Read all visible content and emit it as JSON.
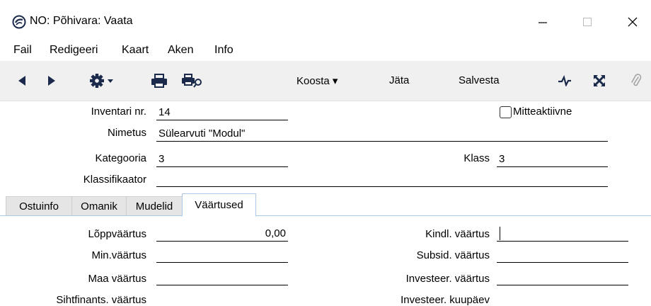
{
  "window": {
    "title": "NO: Põhivara: Vaata",
    "minimize_glyph": "—",
    "maximize_glyph": "☐",
    "close_glyph": "✕"
  },
  "menu": [
    "Fail",
    "Redigeeri",
    "Kaart",
    "Aken",
    "Info"
  ],
  "toolbar": {
    "koosta": "Koosta ▾",
    "jata": "Jäta",
    "salvesta": "Salvesta",
    "icons": [
      "prev-record-icon",
      "next-record-icon",
      "gear-menu-icon",
      "print-icon",
      "print-preview-icon",
      "activity-icon",
      "expand-icon",
      "attachment-icon"
    ]
  },
  "form": {
    "inventari_nr_label": "Inventari nr.",
    "inventari_nr_value": "14",
    "mitteaktiivne_label": "Mitteaktiivne",
    "nimetus_label": "Nimetus",
    "nimetus_value": "Sülearvuti \"Modul\"",
    "kategooria_label": "Kategooria",
    "kategooria_value": "3",
    "klass_label": "Klass",
    "klass_value": "3",
    "klassifikaator_label": "Klassifikaator",
    "klassifikaator_value": ""
  },
  "tabs": [
    "Ostuinfo",
    "Omanik",
    "Mudelid",
    "Väärtused"
  ],
  "active_tab": "Väärtused",
  "values_tab": {
    "loppvaartus_label": "Lõppväärtus",
    "loppvaartus_value": "0,00",
    "min_vaartus_label": "Min.väärtus",
    "maa_vaartus_label": "Maa väärtus",
    "sihtfinants_label": "Sihtfinants. väärtus",
    "kindl_vaartus_label": "Kindl. väärtus",
    "subsid_vaartus_label": "Subsid. väärtus",
    "investeer_vaartus_label": "Investeer. väärtus",
    "investeer_kuupaev_label": "Investeer. kuupäev"
  },
  "colors": {
    "toolbar_bg": "#f0f0f0",
    "tab_accent": "#aac8e8",
    "tab_bg": "#e5e5e5"
  }
}
